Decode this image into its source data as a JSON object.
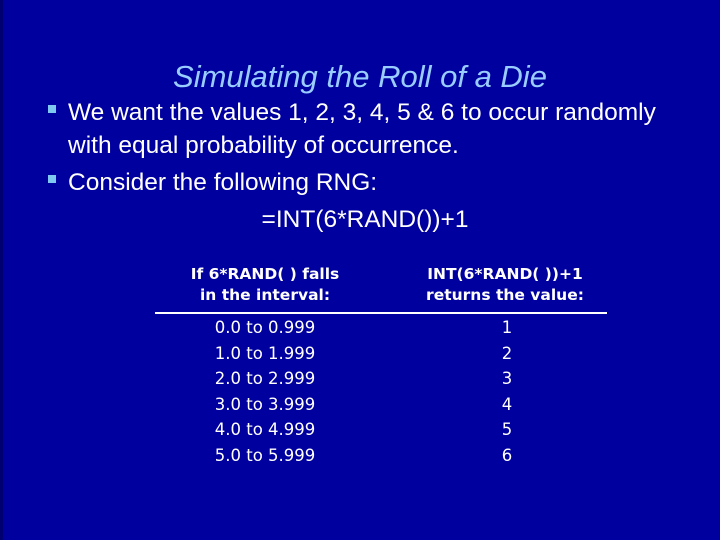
{
  "slide": {
    "title": "Simulating the Roll of a Die",
    "background_color": "#00009E",
    "title_color": "#99CCFF",
    "body_text_color": "#FFFFFF",
    "bullet_marker_color": "#7FC8F0",
    "bullets": [
      {
        "marker": "square-bullet-icon",
        "text": "We want the values 1, 2, 3, 4, 5 & 6 to occur randomly with equal probability of occurrence."
      },
      {
        "marker": "square-bullet-icon",
        "text": "Consider the following RNG:"
      }
    ],
    "formula": "=INT(6*RAND())+1",
    "table": {
      "headers": [
        {
          "line1": "If 6*RAND( ) falls",
          "line2": "in the interval:"
        },
        {
          "line1": "INT(6*RAND( ))+1",
          "line2": "returns the value:"
        }
      ],
      "rows": [
        {
          "interval": "0.0 to 0.999",
          "value": "1"
        },
        {
          "interval": "1.0 to 1.999",
          "value": "2"
        },
        {
          "interval": "2.0 to 2.999",
          "value": "3"
        },
        {
          "interval": "3.0 to 3.999",
          "value": "4"
        },
        {
          "interval": "4.0 to 4.999",
          "value": "5"
        },
        {
          "interval": "5.0 to 5.999",
          "value": "6"
        }
      ]
    }
  }
}
